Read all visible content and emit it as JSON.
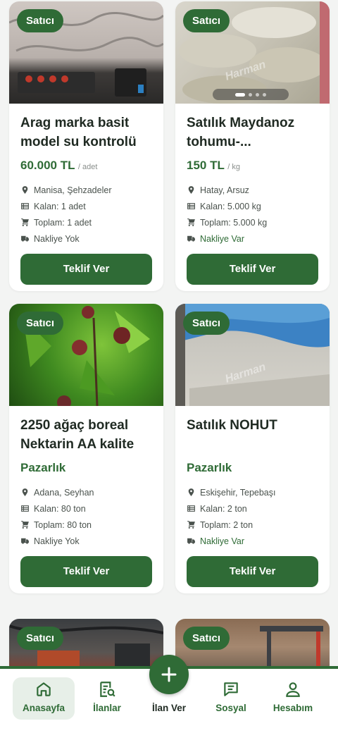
{
  "seller_badge": "Satıcı",
  "listing_button": "Teklif Ver",
  "listings": [
    {
      "title": "Arag marka basit model su kontrolü",
      "price": "60.000 TL",
      "unit": "/ adet",
      "location": "Manisa, Şehzadeler",
      "remaining": "Kalan: 1 adet",
      "total": "Toplam: 1 adet",
      "shipping": "Nakliye Yok",
      "shipping_available": false
    },
    {
      "title": "Satılık Maydanoz tohumu-...",
      "price": "150 TL",
      "unit": "/ kg",
      "location": "Hatay, Arsuz",
      "remaining": "Kalan: 5.000 kg",
      "total": "Toplam: 5.000 kg",
      "shipping": "Nakliye Var",
      "shipping_available": true
    },
    {
      "title": "2250 ağaç boreal Nektarin AA kalite",
      "price": "Pazarlık",
      "unit": "",
      "location": "Adana, Seyhan",
      "remaining": "Kalan: 80 ton",
      "total": "Toplam: 80 ton",
      "shipping": "Nakliye Yok",
      "shipping_available": false
    },
    {
      "title": "Satılık NOHUT",
      "price": "Pazarlık",
      "unit": "",
      "location": "Eskişehir, Tepebaşı",
      "remaining": "Kalan: 2 ton",
      "total": "Toplam: 2 ton",
      "shipping": "Nakliye Var",
      "shipping_available": true
    }
  ],
  "watermark": "Harman",
  "tabs": {
    "home": "Anasayfa",
    "listings": "İlanlar",
    "post": "İlan Ver",
    "social": "Sosyal",
    "account": "Hesabım"
  },
  "colors": {
    "primary": "#2f6b36",
    "background": "#f3f4f3",
    "active_tab_bg": "#e7efe8"
  },
  "icons": [
    "location-pin-icon",
    "stock-list-icon",
    "cart-icon",
    "truck-icon",
    "home-icon",
    "search-list-icon",
    "plus-icon",
    "message-icon",
    "user-icon"
  ]
}
